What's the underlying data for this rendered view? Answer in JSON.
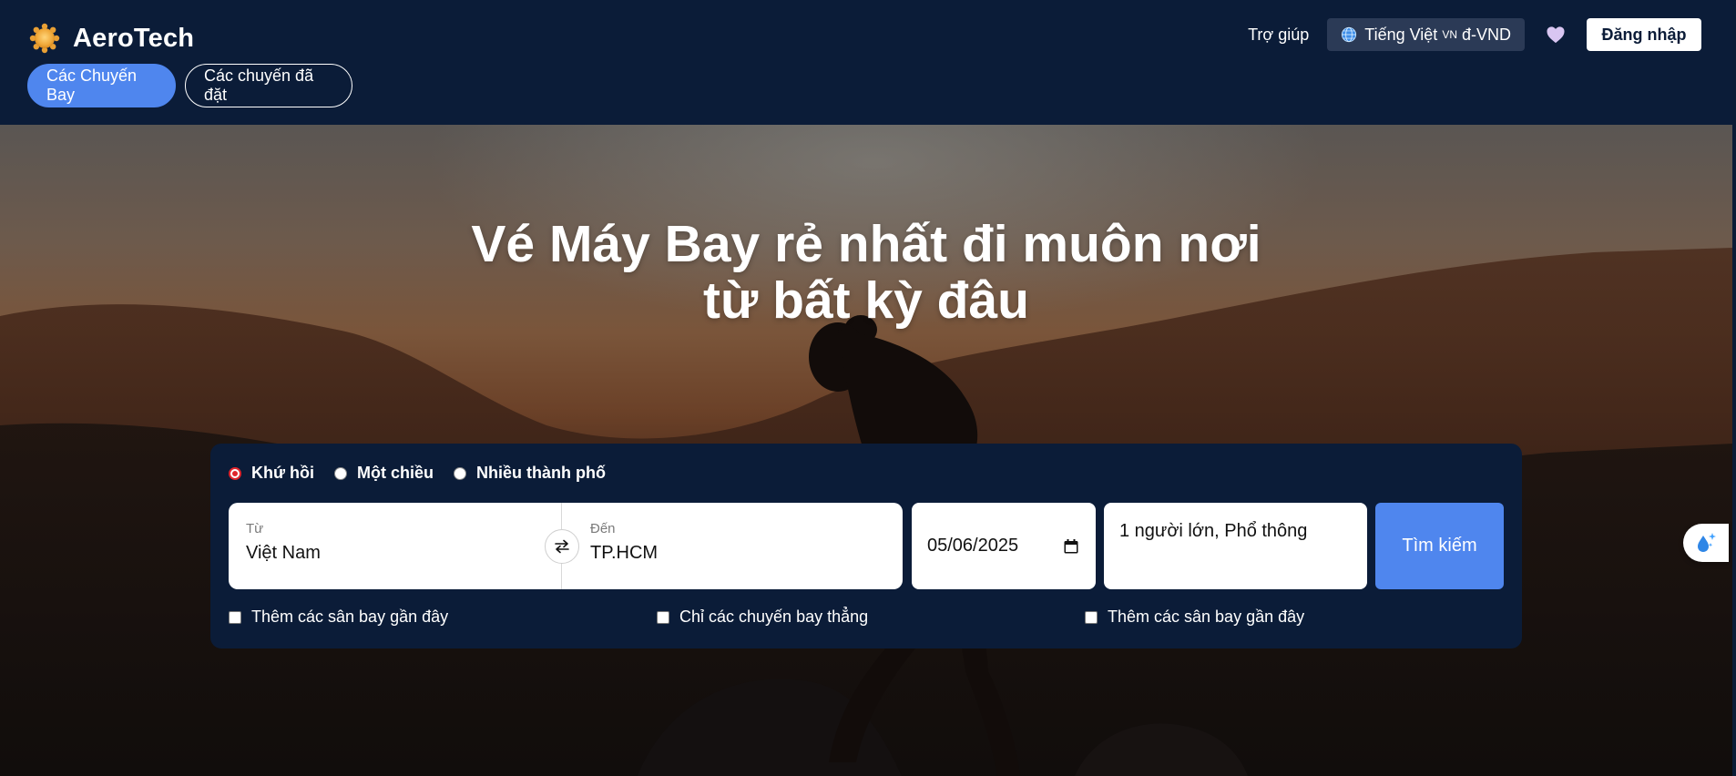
{
  "header": {
    "brand": "AeroTech",
    "tabs": [
      {
        "label": "Các Chuyến Bay",
        "active": true
      },
      {
        "label": "Các chuyến đã đặt",
        "active": false
      }
    ],
    "help": "Trợ giúp",
    "language": {
      "label": "Tiếng Việt",
      "flag": "VN",
      "currency": "đ-VND"
    },
    "login": "Đăng nhập"
  },
  "hero": {
    "title_line1": "Vé Máy Bay rẻ nhất đi muôn nơi",
    "title_line2": "từ bất kỳ đâu"
  },
  "search": {
    "trip_types": [
      {
        "label": "Khứ hồi",
        "checked": true
      },
      {
        "label": "Một chiều",
        "checked": false
      },
      {
        "label": "Nhiều thành phố",
        "checked": false
      }
    ],
    "from": {
      "label": "Từ",
      "value": "Việt Nam"
    },
    "to": {
      "label": "Đến",
      "value": "TP.HCM"
    },
    "date": "05/06/2025",
    "passengers": "1 người lớn, Phổ thông",
    "search_button": "Tìm kiếm",
    "options": [
      {
        "label": "Thêm các sân bay gần đây",
        "checked": false
      },
      {
        "label": "Chỉ các chuyến bay thẳng",
        "checked": false
      },
      {
        "label": "Thêm các sân bay gần đây",
        "checked": false
      }
    ]
  },
  "colors": {
    "header_bg": "#0b1c38",
    "accent": "#4f86ee",
    "radio_checked": "#e0242b"
  },
  "icons": [
    "sun-logo-icon",
    "globe-icon",
    "heart-icon",
    "swap-icon",
    "calendar-icon",
    "water-drop-sparkle-icon"
  ]
}
